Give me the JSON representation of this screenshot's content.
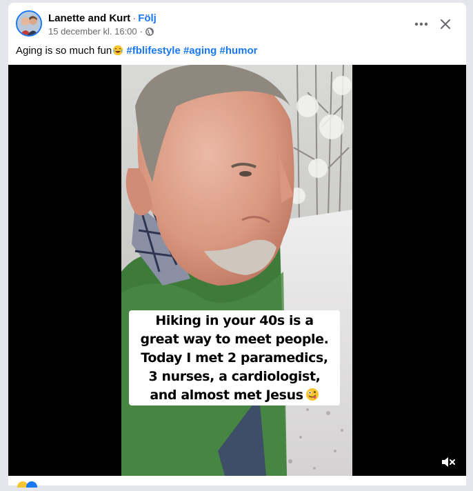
{
  "post": {
    "author": "Lanette and Kurt",
    "separator": "·",
    "follow_label": "Följ",
    "timestamp": "15 december kl. 16:00",
    "timestamp_separator": "·",
    "privacy_icon": "globe-icon",
    "more_icon": "more-horizontal-icon",
    "close_icon": "close-icon",
    "caption_text": "Aging is so much fun",
    "caption_emoji": "laughing-tears-emoji",
    "hashtags": [
      "#fblifestyle",
      "#aging",
      "#humor"
    ]
  },
  "video": {
    "overlay_lines": [
      "Hiking in your 40s is a",
      "great way to meet people.",
      "Today I met 2 paramedics,",
      "3 nurses, a cardiologist,",
      "and almost met Jesus"
    ],
    "overlay_emoji": "zany-face-emoji",
    "mute_icon": "volume-muted-icon"
  },
  "colors": {
    "link_blue": "#1877f2",
    "text_primary": "#050505",
    "text_secondary": "#65676b",
    "page_background": "#e4e6eb",
    "video_background": "#000000"
  }
}
